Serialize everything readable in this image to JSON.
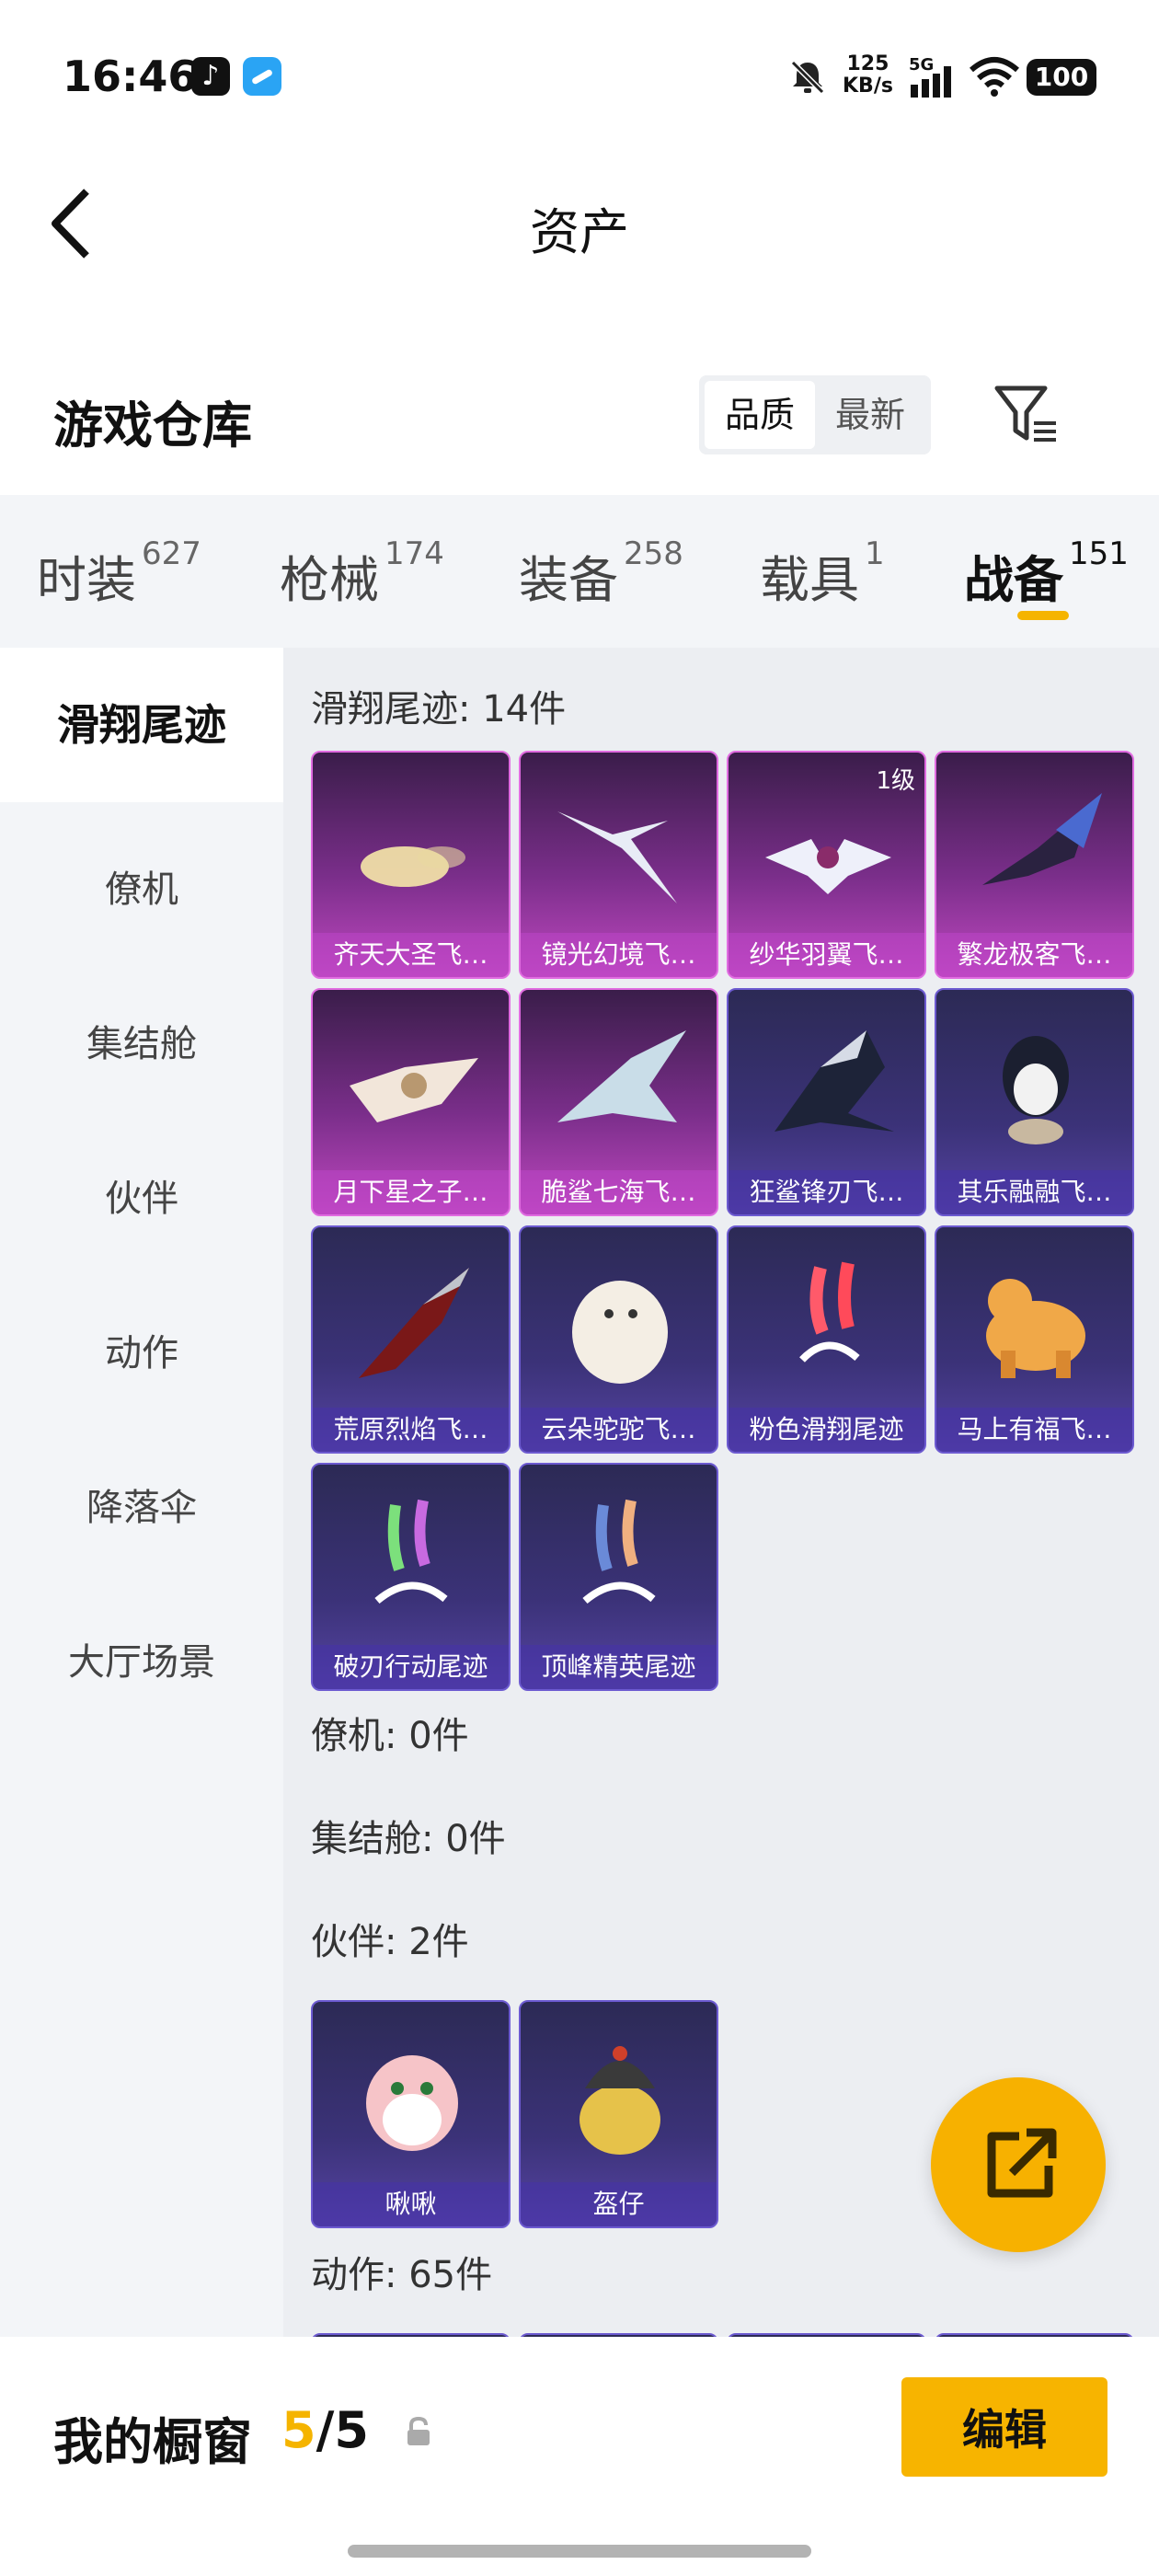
{
  "status_bar": {
    "time": "16:46",
    "net_speed_value": "125",
    "net_speed_unit": "KB/s",
    "network": "5G",
    "battery": "100",
    "icons": [
      "tiktok-icon",
      "app-icon",
      "mute-icon",
      "wifi-icon",
      "battery-icon"
    ]
  },
  "nav": {
    "title": "资产",
    "back_icon": "back-chevron-icon"
  },
  "header": {
    "title": "游戏仓库",
    "sort_options": [
      "品质",
      "最新"
    ],
    "sort_selected": "品质",
    "filter_icon": "filter-icon"
  },
  "category_tabs": [
    {
      "label": "时装",
      "count": "627",
      "active": false
    },
    {
      "label": "枪械",
      "count": "174",
      "active": false
    },
    {
      "label": "装备",
      "count": "258",
      "active": false
    },
    {
      "label": "载具",
      "count": "1",
      "active": false
    },
    {
      "label": "战备",
      "count": "151",
      "active": true
    }
  ],
  "sub_nav": [
    "滑翔尾迹",
    "僚机",
    "集结舱",
    "伙伴",
    "动作",
    "降落伞",
    "大厅场景"
  ],
  "sub_nav_active": "滑翔尾迹",
  "sections": [
    {
      "title": "滑翔尾迹: 14件",
      "items": [
        {
          "name": "齐天大圣飞…",
          "style": "pink"
        },
        {
          "name": "镜光幻境飞…",
          "style": "pink"
        },
        {
          "name": "纱华羽翼飞…",
          "style": "pink",
          "level": "1级"
        },
        {
          "name": "繁龙极客飞…",
          "style": "pink"
        },
        {
          "name": "月下星之子…",
          "style": "pink"
        },
        {
          "name": "脆鲨七海飞…",
          "style": "pink"
        },
        {
          "name": "狂鲨锋刃飞…",
          "style": "blue"
        },
        {
          "name": "其乐融融飞…",
          "style": "blue"
        },
        {
          "name": "荒原烈焰飞…",
          "style": "blue"
        },
        {
          "name": "云朵驼驼飞…",
          "style": "blue"
        },
        {
          "name": "粉色滑翔尾迹",
          "style": "blue"
        },
        {
          "name": "马上有福飞…",
          "style": "blue"
        },
        {
          "name": "破刃行动尾迹",
          "style": "blue"
        },
        {
          "name": "顶峰精英尾迹",
          "style": "blue"
        }
      ]
    },
    {
      "title": "僚机: 0件",
      "items": []
    },
    {
      "title": "集结舱: 0件",
      "items": []
    },
    {
      "title": "伙伴: 2件",
      "items": [
        {
          "name": "啾啾",
          "style": "blue"
        },
        {
          "name": "盔仔",
          "style": "blue"
        }
      ]
    },
    {
      "title": "动作: 65件",
      "items": []
    }
  ],
  "share_icon": "share-external-icon",
  "bottom_bar": {
    "label": "我的橱窗",
    "current": "5",
    "separator": "/",
    "total": "5",
    "lock_icon": "lock-icon",
    "edit_label": "编辑"
  }
}
